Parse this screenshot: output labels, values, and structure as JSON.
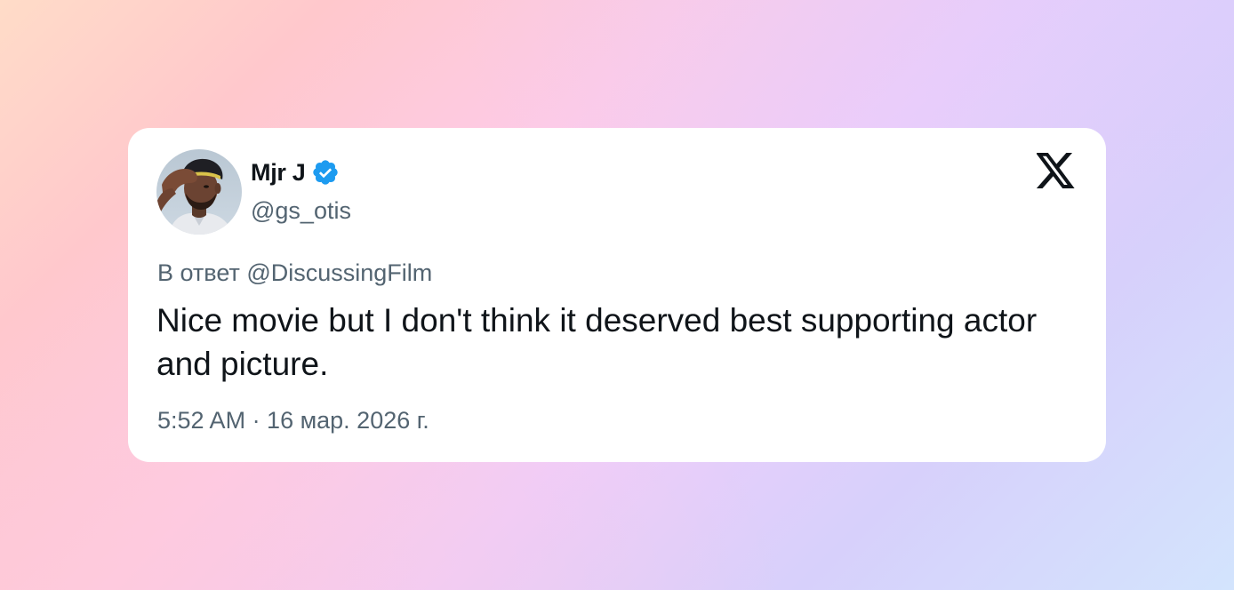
{
  "tweet": {
    "author": {
      "display_name": "Mjr J",
      "handle": "@gs_otis",
      "verified": true,
      "verified_icon": "verified-badge-icon",
      "avatar": "profile-photo"
    },
    "reply_to": "В ответ @DiscussingFilm",
    "text": "Nice movie but I don't think it deserved best supporting actor and picture.",
    "timestamp": "5:52 AM · 16 мар. 2026 г."
  },
  "brand": {
    "logo_icon": "x-logo-icon"
  },
  "colors": {
    "card_bg": "#ffffff",
    "text_primary": "#0f1419",
    "text_secondary": "#536471",
    "verified_blue": "#1d9bf0"
  }
}
